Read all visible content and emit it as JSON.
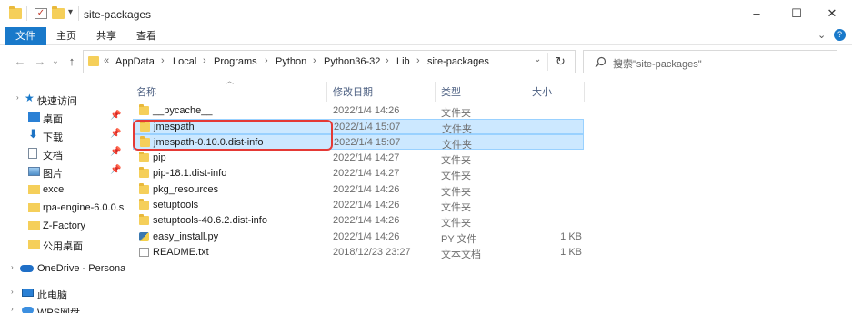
{
  "window": {
    "title": "site-packages",
    "minimize": "–",
    "maximize": "☐",
    "close": "✕"
  },
  "ribbon": {
    "tabs": [
      "文件",
      "主页",
      "共享",
      "查看"
    ],
    "expand": "⌄",
    "help": "?"
  },
  "nav": {
    "back": "←",
    "forward": "→",
    "recent": "⌄",
    "up": "↑",
    "refresh": "↻",
    "dropdown": "⌄"
  },
  "address": {
    "prefix": "«",
    "path": [
      "AppData",
      "Local",
      "Programs",
      "Python",
      "Python36-32",
      "Lib",
      "site-packages"
    ],
    "separator": "›"
  },
  "search": {
    "placeholder": "搜索\"site-packages\""
  },
  "sidebar": {
    "items": [
      {
        "label": "快速访问",
        "icon": "star-icon",
        "pinned": false
      },
      {
        "label": "桌面",
        "icon": "desktop-icon",
        "pinned": true
      },
      {
        "label": "下载",
        "icon": "download-icon",
        "pinned": true
      },
      {
        "label": "文档",
        "icon": "document-icon",
        "pinned": true
      },
      {
        "label": "图片",
        "icon": "picture-icon",
        "pinned": true
      },
      {
        "label": "excel",
        "icon": "folder-icon",
        "pinned": false
      },
      {
        "label": "rpa-engine-6.0.0.s",
        "icon": "folder-icon",
        "pinned": false
      },
      {
        "label": "Z-Factory",
        "icon": "folder-icon",
        "pinned": false
      },
      {
        "label": "公用桌面",
        "icon": "folder-icon",
        "pinned": false
      },
      {
        "label": "OneDrive - Persona",
        "icon": "cloud-icon",
        "pinned": false
      },
      {
        "label": "此电脑",
        "icon": "computer-icon",
        "pinned": false
      },
      {
        "label": "WPS网盘",
        "icon": "cloud-drive-icon",
        "pinned": false
      }
    ]
  },
  "columns": {
    "name": "名称",
    "date": "修改日期",
    "type": "类型",
    "size": "大小"
  },
  "files": [
    {
      "name": "__pycache__",
      "date": "2022/1/4 14:26",
      "type": "文件夹",
      "size": "",
      "kind": "folder",
      "selected": false
    },
    {
      "name": "jmespath",
      "date": "2022/1/4 15:07",
      "type": "文件夹",
      "size": "",
      "kind": "folder",
      "selected": true
    },
    {
      "name": "jmespath-0.10.0.dist-info",
      "date": "2022/1/4 15:07",
      "type": "文件夹",
      "size": "",
      "kind": "folder",
      "selected": true
    },
    {
      "name": "pip",
      "date": "2022/1/4 14:27",
      "type": "文件夹",
      "size": "",
      "kind": "folder",
      "selected": false
    },
    {
      "name": "pip-18.1.dist-info",
      "date": "2022/1/4 14:27",
      "type": "文件夹",
      "size": "",
      "kind": "folder",
      "selected": false
    },
    {
      "name": "pkg_resources",
      "date": "2022/1/4 14:26",
      "type": "文件夹",
      "size": "",
      "kind": "folder",
      "selected": false
    },
    {
      "name": "setuptools",
      "date": "2022/1/4 14:26",
      "type": "文件夹",
      "size": "",
      "kind": "folder",
      "selected": false
    },
    {
      "name": "setuptools-40.6.2.dist-info",
      "date": "2022/1/4 14:26",
      "type": "文件夹",
      "size": "",
      "kind": "folder",
      "selected": false
    },
    {
      "name": "easy_install.py",
      "date": "2022/1/4 14:26",
      "type": "PY 文件",
      "size": "1 KB",
      "kind": "py",
      "selected": false
    },
    {
      "name": "README.txt",
      "date": "2018/12/23 23:27",
      "type": "文本文档",
      "size": "1 KB",
      "kind": "txt",
      "selected": false
    }
  ],
  "colors": {
    "accent": "#1979ca",
    "selection": "#cce8ff",
    "highlight_box": "#e53935",
    "folder": "#f5cf5a"
  }
}
